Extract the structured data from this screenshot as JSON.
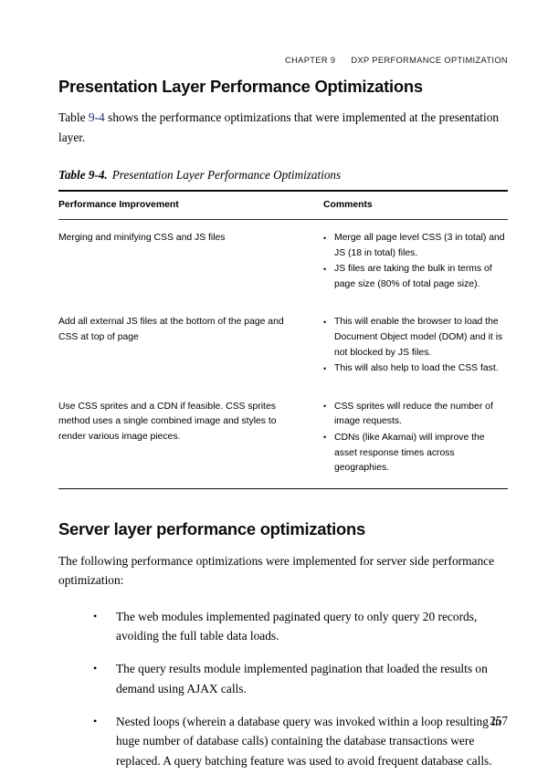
{
  "running_header": {
    "chapter": "CHAPTER 9",
    "title": "DXP PERFORMANCE OPTIMIZATION"
  },
  "colors": {
    "xref_blue": "#1f2a63",
    "text_black": "#000000",
    "rule_black": "#0d0d0d"
  },
  "section1": {
    "heading": "Presentation Layer Performance Optimizations",
    "intro_before": "Table ",
    "intro_xref": "9-4",
    "intro_after": " shows the performance optimizations that were implemented at the presentation layer.",
    "table_caption_label": "Table 9-4.",
    "table_caption_text": "Presentation Layer Performance Optimizations",
    "table": {
      "headers": [
        "Performance Improvement",
        "Comments"
      ],
      "rows": [
        {
          "improvement": "Merging and minifying CSS and JS files",
          "comments": [
            "Merge all page level CSS (3 in total) and JS (18 in total) files.",
            "JS files are taking the bulk in terms of page size (80% of total page size)."
          ]
        },
        {
          "improvement": "Add all external JS files at the bottom of the page and CSS at top of page",
          "comments": [
            "This will enable the browser to load the Document Object model (DOM) and it is not blocked by JS files.",
            "This will also help to load the CSS fast."
          ]
        },
        {
          "improvement": "Use CSS sprites and a CDN if feasible. CSS sprites method uses a single combined image and styles to render various image pieces.",
          "comments": [
            "CSS sprites will reduce the number of image requests.",
            "CDNs (like Akamai) will improve the asset response times across geographies."
          ]
        }
      ]
    }
  },
  "section2": {
    "heading": "Server layer performance optimizations",
    "intro": "The following performance optimizations were implemented for server side performance optimization:",
    "bullets": [
      "The web modules implemented paginated query to only query 20 records, avoiding the full table data loads.",
      "The query results module implemented pagination that loaded the results on demand using AJAX calls.",
      "Nested loops (wherein a database query was invoked within a loop resulting in huge number of database calls) containing the database transactions were replaced. A query batching feature was used to avoid frequent database calls."
    ]
  },
  "folio": {
    "page_number": "257"
  }
}
